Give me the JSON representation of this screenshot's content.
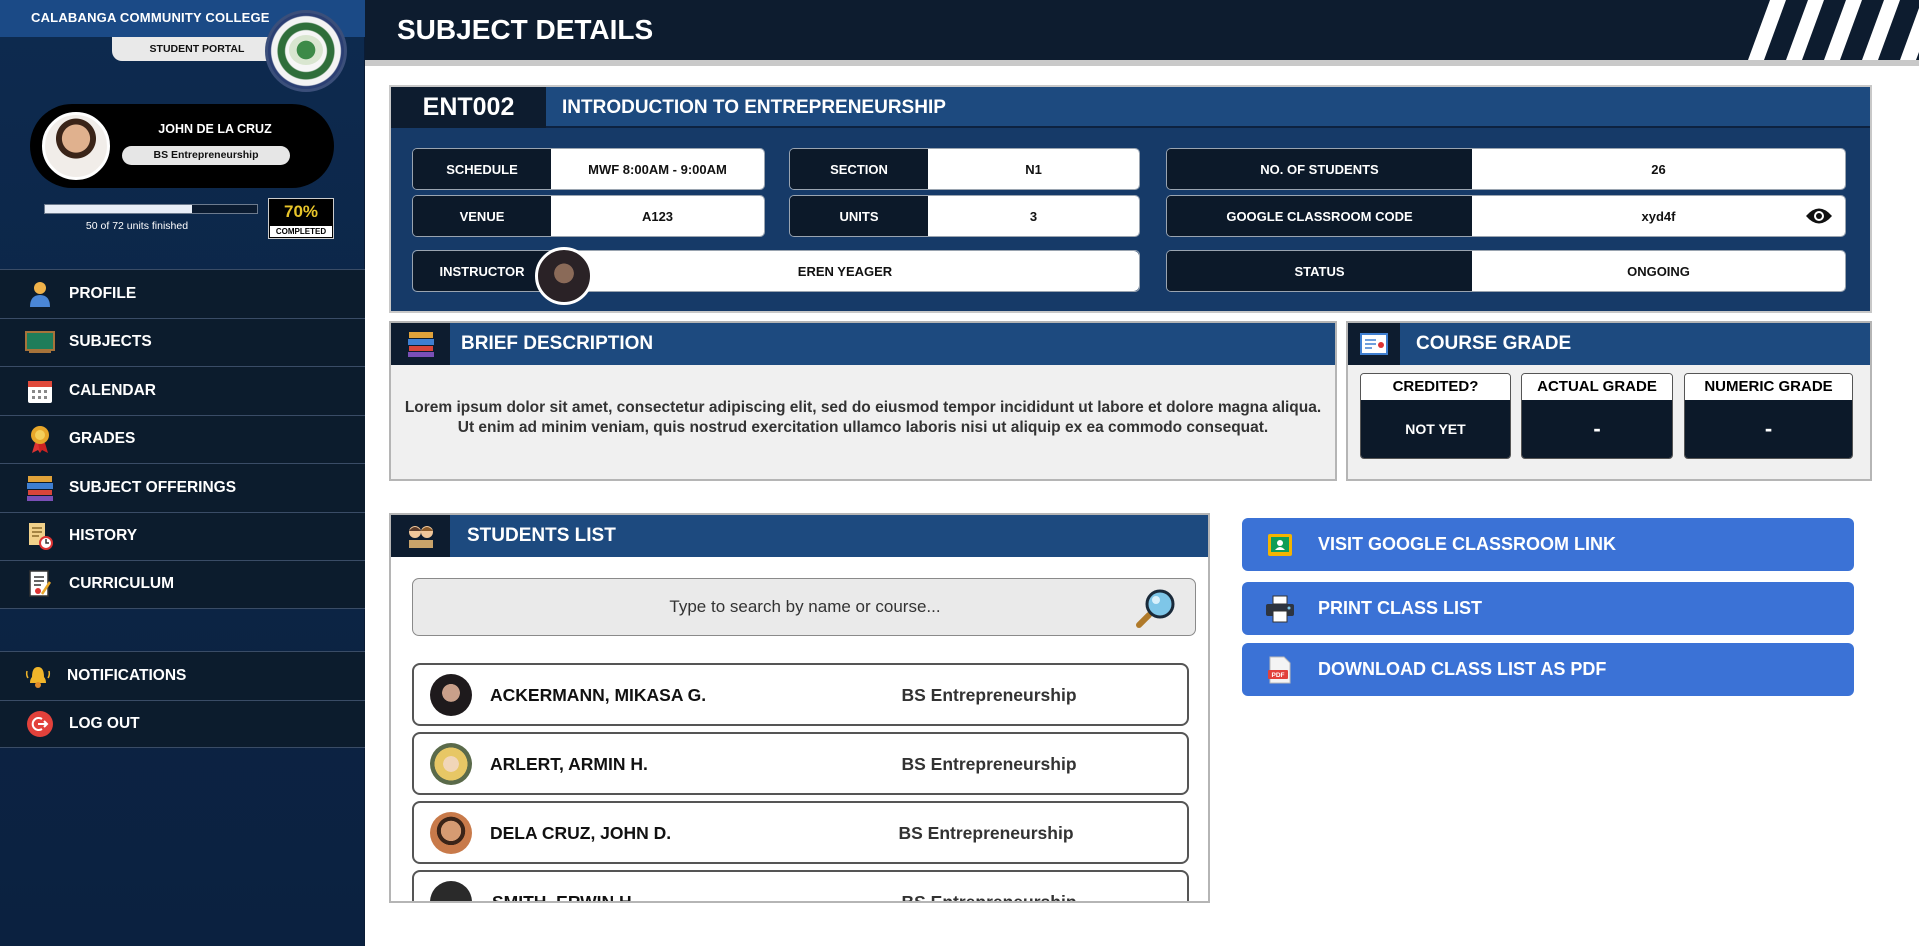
{
  "sidebar": {
    "college": "CALABANGA COMMUNITY COLLEGE",
    "portal": "STUDENT PORTAL",
    "user": {
      "name": "JOHN DE LA CRUZ",
      "course": "BS Entrepreneurship"
    },
    "progress": {
      "fraction": 0.694,
      "text": "50 of 72 units finished",
      "percent": "70%",
      "percent_label": "COMPLETED"
    },
    "nav": [
      {
        "label": "PROFILE",
        "icon": "person-icon"
      },
      {
        "label": "SUBJECTS",
        "icon": "chalkboard-icon"
      },
      {
        "label": "CALENDAR",
        "icon": "calendar-icon"
      },
      {
        "label": "GRADES",
        "icon": "medal-icon"
      },
      {
        "label": "SUBJECT OFFERINGS",
        "icon": "books-icon"
      },
      {
        "label": "HISTORY",
        "icon": "scroll-clock-icon"
      },
      {
        "label": "CURRICULUM",
        "icon": "document-icon"
      }
    ],
    "nav2": [
      {
        "label": "NOTIFICATIONS",
        "icon": "bell-icon"
      },
      {
        "label": "LOG OUT",
        "icon": "logout-icon"
      }
    ]
  },
  "header": {
    "title": "SUBJECT DETAILS"
  },
  "subject": {
    "code": "ENT002",
    "name": "INTRODUCTION TO ENTREPRENEURSHIP",
    "fields": {
      "schedule": {
        "label": "SCHEDULE",
        "value": "MWF 8:00AM - 9:00AM"
      },
      "section": {
        "label": "SECTION",
        "value": "N1"
      },
      "students": {
        "label": "NO. OF STUDENTS",
        "value": "26"
      },
      "venue": {
        "label": "VENUE",
        "value": "A123"
      },
      "units": {
        "label": "UNITS",
        "value": "3"
      },
      "classroom": {
        "label": "GOOGLE CLASSROOM CODE",
        "value": "xyd4f"
      },
      "instructor": {
        "label": "INSTRUCTOR",
        "value": "EREN YEAGER"
      },
      "status": {
        "label": "STATUS",
        "value": "ONGOING"
      }
    }
  },
  "description": {
    "title": "BRIEF DESCRIPTION",
    "text": "Lorem ipsum dolor sit amet, consectetur adipiscing elit, sed do eiusmod tempor incididunt ut labore et dolore magna aliqua. Ut enim ad minim veniam, quis nostrud exercitation ullamco laboris nisi ut aliquip ex ea commodo consequat."
  },
  "grade": {
    "title": "COURSE GRADE",
    "credited": {
      "label": "CREDITED?",
      "value": "NOT YET"
    },
    "actual": {
      "label": "ACTUAL GRADE",
      "value": "-"
    },
    "numeric": {
      "label": "NUMERIC GRADE",
      "value": "-"
    }
  },
  "students": {
    "title": "STUDENTS LIST",
    "search_placeholder": "Type to search by name or course...",
    "rows": [
      {
        "name": "ACKERMANN, MIKASA G.",
        "course": "BS Entrepreneurship"
      },
      {
        "name": "ARLERT, ARMIN H.",
        "course": "BS Entrepreneurship"
      },
      {
        "name": "DELA CRUZ, JOHN D.",
        "course": "BS Entrepreneurship"
      },
      {
        "name": "SMITH, ERWIN H.",
        "course": "BS Entrepreneurship"
      }
    ]
  },
  "actions": {
    "classroom": "VISIT GOOGLE CLASSROOM LINK",
    "print": "PRINT CLASS LIST",
    "download": "DOWNLOAD CLASS LIST AS PDF"
  },
  "colors": {
    "accent": "#3b72d6",
    "navy": "#0d1c2f",
    "panel_blue": "#1d4a7f",
    "percent_yellow": "#e8c52a"
  }
}
